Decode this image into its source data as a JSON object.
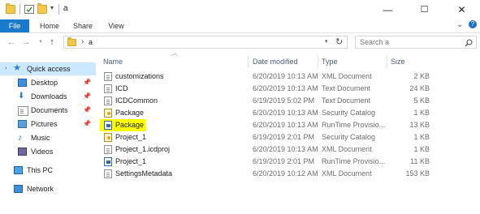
{
  "window": {
    "title": "a",
    "minimize": "—",
    "maximize": "☐",
    "close": "✕"
  },
  "ribbon": {
    "tabs": [
      {
        "label": "File"
      },
      {
        "label": "Home"
      },
      {
        "label": "Share"
      },
      {
        "label": "View"
      }
    ],
    "expand_icon": "⌄",
    "help_icon": "?"
  },
  "address": {
    "path_separator": "›",
    "path_segment": "a",
    "search_placeholder": "Search a"
  },
  "nav": {
    "items": [
      {
        "label": "Quick access",
        "icon": "star-icon",
        "pinned": false
      },
      {
        "label": "Desktop",
        "icon": "desktop-icon",
        "pinned": true
      },
      {
        "label": "Downloads",
        "icon": "downloads-icon",
        "pinned": true
      },
      {
        "label": "Documents",
        "icon": "documents-icon",
        "pinned": true
      },
      {
        "label": "Pictures",
        "icon": "pictures-icon",
        "pinned": true
      },
      {
        "label": "Music",
        "icon": "music-icon",
        "pinned": false
      },
      {
        "label": "Videos",
        "icon": "videos-icon",
        "pinned": false
      },
      {
        "label": "This PC",
        "icon": "computer-icon",
        "pinned": false
      },
      {
        "label": "Network",
        "icon": "network-icon",
        "pinned": false
      }
    ]
  },
  "list": {
    "columns": [
      "Name",
      "Date modified",
      "Type",
      "Size"
    ],
    "rows": [
      {
        "name": "customizations",
        "date": "6/20/2019 10:13 AM",
        "type": "XML Document",
        "size": "2 KB",
        "icon": "xml-file-icon"
      },
      {
        "name": "ICD",
        "date": "6/20/2019 10:13 AM",
        "type": "Text Document",
        "size": "24 KB",
        "icon": "text-file-icon"
      },
      {
        "name": "ICDCommon",
        "date": "6/19/2019 5:02 PM",
        "type": "Text Document",
        "size": "5 KB",
        "icon": "text-file-icon"
      },
      {
        "name": "Package",
        "date": "6/20/2019 10:13 AM",
        "type": "Security Catalog",
        "size": "1 KB",
        "icon": "catalog-file-icon"
      },
      {
        "name": "Package",
        "date": "6/20/2019 10:13 AM",
        "type": "RunTime Provisio...",
        "size": "13 KB",
        "icon": "provisioning-package-icon",
        "highlighted": true
      },
      {
        "name": "Project_1",
        "date": "6/19/2019 2:01 PM",
        "type": "Security Catalog",
        "size": "1 KB",
        "icon": "catalog-file-icon"
      },
      {
        "name": "Project_1.icdproj",
        "date": "6/20/2019 10:13 AM",
        "type": "XML Document",
        "size": "1 KB",
        "icon": "xml-file-icon"
      },
      {
        "name": "Project_1",
        "date": "6/19/2019 2:01 PM",
        "type": "RunTime Provisio...",
        "size": "11 KB",
        "icon": "provisioning-package-icon"
      },
      {
        "name": "SettingsMetadata",
        "date": "6/20/2019 10:12 AM",
        "type": "XML Document",
        "size": "153 KB",
        "icon": "xml-file-icon"
      }
    ]
  },
  "colors": {
    "file_tab": "#1979ca",
    "quick_access_selected": "#cce8ff",
    "highlight": "#ffff00",
    "folder": "#f3c84d"
  }
}
